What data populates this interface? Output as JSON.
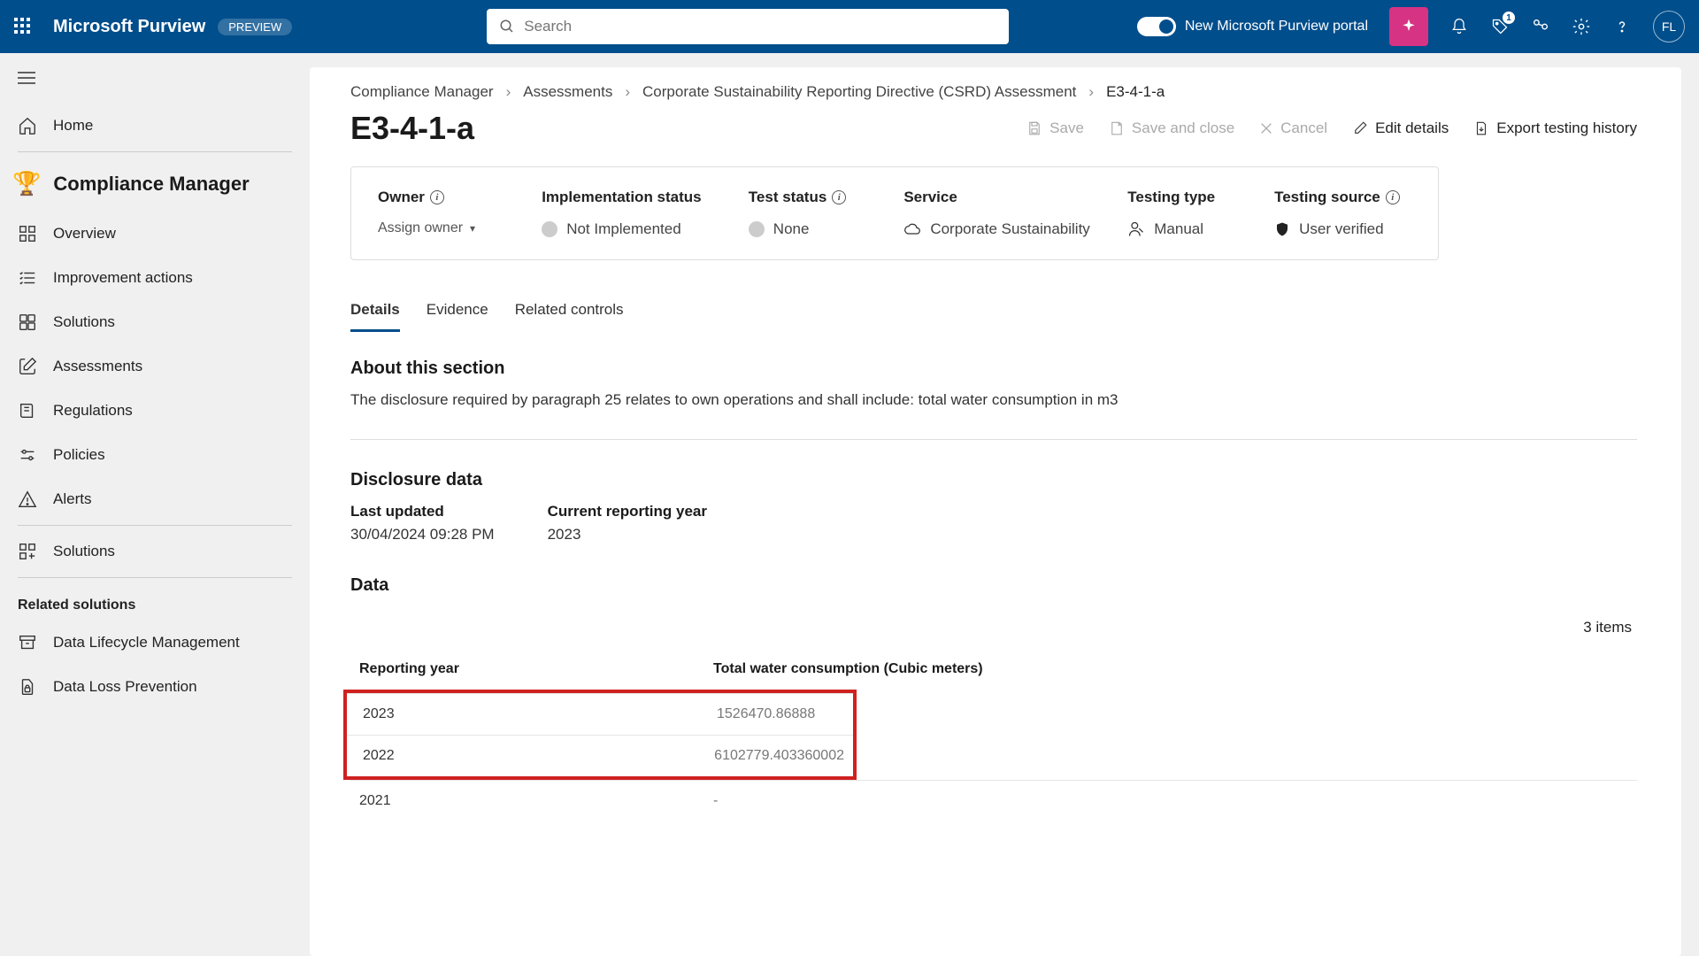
{
  "topbar": {
    "brand": "Microsoft Purview",
    "badge": "PREVIEW",
    "search_placeholder": "Search",
    "toggle_label": "New Microsoft Purview portal",
    "notification_count": "1",
    "avatar_initials": "FL"
  },
  "sidebar": {
    "home": "Home",
    "section_title": "Compliance Manager",
    "items": [
      {
        "label": "Overview"
      },
      {
        "label": "Improvement actions"
      },
      {
        "label": "Solutions"
      },
      {
        "label": "Assessments"
      },
      {
        "label": "Regulations"
      },
      {
        "label": "Policies"
      },
      {
        "label": "Alerts"
      }
    ],
    "solutions2": "Solutions",
    "related_label": "Related solutions",
    "related": [
      {
        "label": "Data Lifecycle Management"
      },
      {
        "label": "Data Loss Prevention"
      }
    ]
  },
  "breadcrumb": {
    "a": "Compliance Manager",
    "b": "Assessments",
    "c": "Corporate Sustainability Reporting Directive (CSRD) Assessment",
    "d": "E3-4-1-a"
  },
  "page": {
    "title": "E3-4-1-a",
    "actions": {
      "save": "Save",
      "save_close": "Save and close",
      "cancel": "Cancel",
      "edit": "Edit details",
      "export": "Export testing history"
    }
  },
  "info": {
    "owner_label": "Owner",
    "owner_value": "Assign owner",
    "impl_label": "Implementation status",
    "impl_value": "Not Implemented",
    "test_label": "Test status",
    "test_value": "None",
    "service_label": "Service",
    "service_value": "Corporate Sustainability",
    "ttype_label": "Testing type",
    "ttype_value": "Manual",
    "tsource_label": "Testing source",
    "tsource_value": "User verified"
  },
  "tabs": {
    "details": "Details",
    "evidence": "Evidence",
    "related": "Related controls"
  },
  "about": {
    "heading": "About this section",
    "text": "The disclosure required by paragraph 25 relates to own operations and shall include: total water consumption in m3"
  },
  "disclosure": {
    "heading": "Disclosure data",
    "last_updated_label": "Last updated",
    "last_updated_value": "30/04/2024 09:28 PM",
    "year_label": "Current reporting year",
    "year_value": "2023",
    "data_heading": "Data",
    "items_count": "3 items",
    "col1": "Reporting year",
    "col2": "Total water consumption (Cubic meters)",
    "rows": [
      {
        "year": "2023",
        "value": "1526470.86888"
      },
      {
        "year": "2022",
        "value": "6102779.403360002"
      },
      {
        "year": "2021",
        "value": "-"
      }
    ]
  }
}
